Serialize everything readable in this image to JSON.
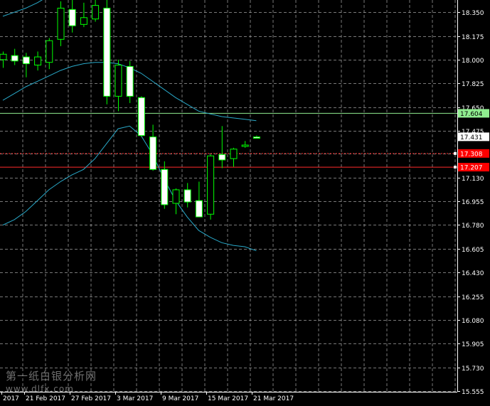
{
  "watermark": {
    "line1": "第一纸白银分析网",
    "line2": "www.dlfx.com"
  },
  "colors": {
    "background": "#000000",
    "grid": "#b8b8b8",
    "axis": "#ffffff",
    "text": "#ffffff",
    "bull": "#00ff00",
    "bull_fill": "#000000",
    "bear_fill": "#ffffff",
    "bollinger": "#29a9c9",
    "green_line": "#90ee90",
    "red_line": "#ff2a2a",
    "green_label_bg": "#90ee90",
    "red_label_bg": "#ff0000",
    "current_label_bg": "#ffffff"
  },
  "chart_data": {
    "type": "candlestick",
    "ylim": [
      15.55,
      18.44
    ],
    "y_ticks": [
      "18.350",
      "18.175",
      "18.000",
      "17.825",
      "17.650",
      "17.475",
      "17.305",
      "17.130",
      "16.955",
      "16.780",
      "16.605",
      "16.430",
      "16.255",
      "16.080",
      "15.905",
      "15.730",
      "15.555"
    ],
    "x_labels": [
      "2017",
      "21 Feb 2017",
      "27 Feb 2017",
      "3 Mar 2017",
      "9 Mar 2017",
      "15 Mar 2017",
      "21 Mar 2017"
    ],
    "price_labels": {
      "green_line": "17.604",
      "current": "17.431",
      "red_dotted": "17.308",
      "red_line": "17.207"
    },
    "horizontal_lines": {
      "green_line": 17.604,
      "red_dotted": 17.308,
      "red_line": 17.207
    },
    "candles": [
      {
        "o": 18.0,
        "h": 18.06,
        "l": 17.94,
        "c": 18.04
      },
      {
        "o": 18.03,
        "h": 18.08,
        "l": 17.96,
        "c": 17.99
      },
      {
        "o": 18.02,
        "h": 18.05,
        "l": 17.87,
        "c": 17.97
      },
      {
        "o": 17.96,
        "h": 18.06,
        "l": 17.92,
        "c": 18.02
      },
      {
        "o": 17.98,
        "h": 18.16,
        "l": 17.93,
        "c": 18.14
      },
      {
        "o": 18.15,
        "h": 18.43,
        "l": 18.1,
        "c": 18.38
      },
      {
        "o": 18.37,
        "h": 18.44,
        "l": 18.2,
        "c": 18.25
      },
      {
        "o": 18.26,
        "h": 18.42,
        "l": 18.24,
        "c": 18.31
      },
      {
        "o": 18.3,
        "h": 18.44,
        "l": 18.28,
        "c": 18.4
      },
      {
        "o": 18.38,
        "h": 18.44,
        "l": 17.67,
        "c": 17.73
      },
      {
        "o": 17.73,
        "h": 18.0,
        "l": 17.62,
        "c": 17.96
      },
      {
        "o": 17.95,
        "h": 17.99,
        "l": 17.68,
        "c": 17.73
      },
      {
        "o": 17.72,
        "h": 17.73,
        "l": 17.43,
        "c": 17.44
      },
      {
        "o": 17.43,
        "h": 17.52,
        "l": 17.18,
        "c": 17.19
      },
      {
        "o": 17.19,
        "h": 17.25,
        "l": 16.9,
        "c": 16.93
      },
      {
        "o": 16.94,
        "h": 17.05,
        "l": 16.86,
        "c": 17.04
      },
      {
        "o": 17.04,
        "h": 17.09,
        "l": 16.91,
        "c": 16.95
      },
      {
        "o": 16.96,
        "h": 17.1,
        "l": 16.84,
        "c": 16.84
      },
      {
        "o": 16.86,
        "h": 17.3,
        "l": 16.82,
        "c": 17.29
      },
      {
        "o": 17.3,
        "h": 17.51,
        "l": 17.2,
        "c": 17.26
      },
      {
        "o": 17.27,
        "h": 17.35,
        "l": 17.21,
        "c": 17.34
      },
      {
        "o": 17.36,
        "h": 17.4,
        "l": 17.35,
        "c": 17.37
      },
      {
        "o": 17.43,
        "h": 17.44,
        "l": 17.42,
        "c": 17.42
      }
    ],
    "bollinger": {
      "upper": [
        18.32,
        18.35,
        18.38,
        18.42,
        18.47,
        18.52,
        18.56,
        18.58,
        18.6
      ],
      "middle": [
        17.7,
        17.75,
        17.8,
        17.84,
        17.88,
        17.92,
        17.95,
        17.97,
        17.98,
        17.98,
        17.97,
        17.94,
        17.9,
        17.84,
        17.78,
        17.72,
        17.67,
        17.62,
        17.6,
        17.58,
        17.57,
        17.56,
        17.55
      ],
      "lower": [
        16.78,
        16.82,
        16.88,
        16.96,
        17.04,
        17.1,
        17.15,
        17.19,
        17.27,
        17.38,
        17.49,
        17.51,
        17.44,
        17.3,
        17.12,
        16.96,
        16.84,
        16.74,
        16.69,
        16.65,
        16.63,
        16.62,
        16.59
      ]
    }
  }
}
